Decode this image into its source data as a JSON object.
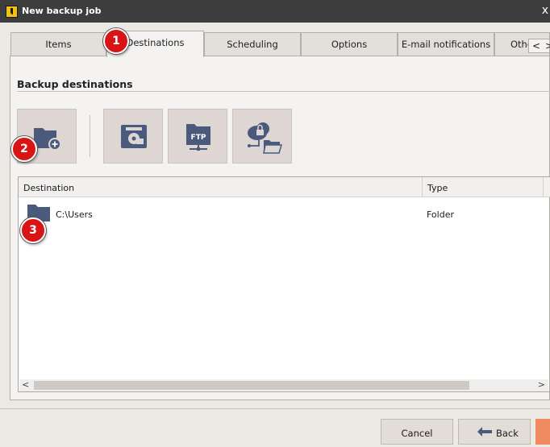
{
  "window": {
    "title": "New backup job",
    "app_icon": "backup-app-icon",
    "close_glyph": "x"
  },
  "tabs": [
    {
      "label": "Items",
      "active": false
    },
    {
      "label": "Destinations",
      "active": true
    },
    {
      "label": "Scheduling",
      "active": false
    },
    {
      "label": "Options",
      "active": false
    },
    {
      "label": "E-mail notifications",
      "active": false
    },
    {
      "label": "Othe",
      "active": false
    }
  ],
  "tab_scroll": {
    "left_glyph": "<",
    "right_glyph": ">"
  },
  "section": {
    "title": "Backup destinations"
  },
  "toolbar": {
    "buttons": [
      {
        "icon": "add-folder-icon"
      },
      {
        "icon": "disk-drive-icon"
      },
      {
        "icon": "ftp-folder-icon"
      },
      {
        "icon": "cloud-lock-folder-icon"
      }
    ]
  },
  "list": {
    "columns": [
      "Destination",
      "Type"
    ],
    "rows": [
      {
        "path": "C:\\Users",
        "type": "Folder",
        "icon": "folder-icon"
      }
    ],
    "scroll_left_glyph": "<",
    "scroll_right_glyph": ">"
  },
  "footer": {
    "cancel_label": "Cancel",
    "back_label": "Back"
  },
  "badges": [
    "1",
    "2",
    "3"
  ],
  "colors": {
    "badge": "#d81414",
    "icon": "#4a5a7c",
    "next_button": "#f08a60",
    "titlebar": "#3d3d3d"
  }
}
